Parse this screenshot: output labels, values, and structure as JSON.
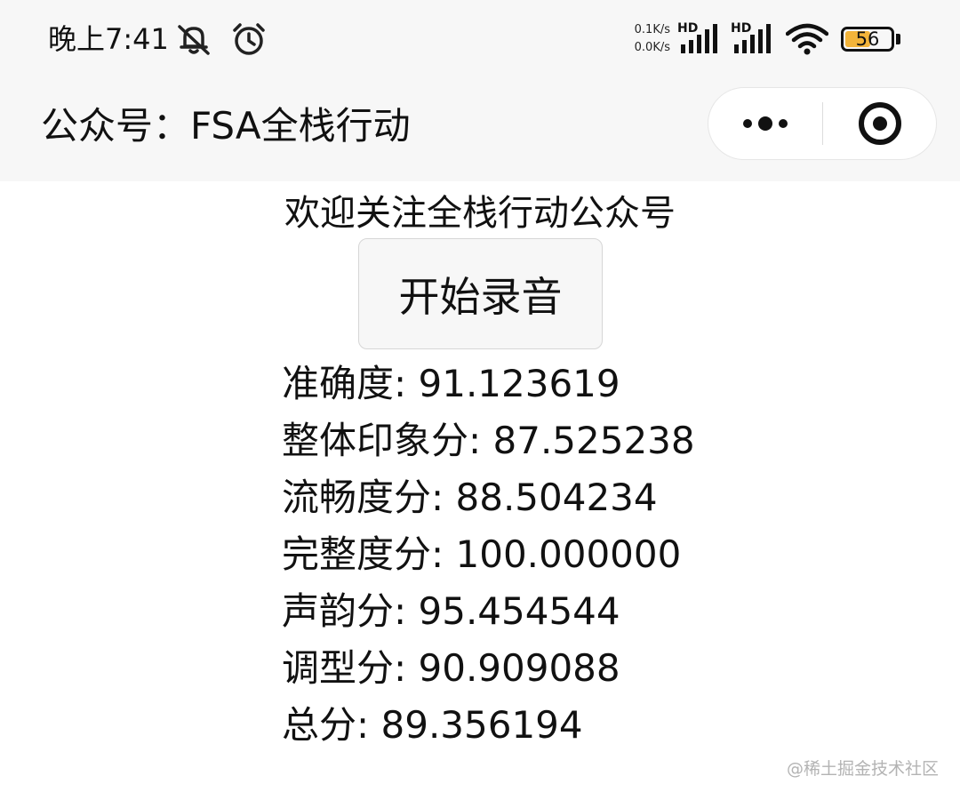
{
  "status_bar": {
    "time": "晚上7:41",
    "icons": [
      "mute-icon",
      "alarm-icon"
    ],
    "net_speed_up": "0.1K/s",
    "net_speed_down": "0.0K/s",
    "signal_1_label": "HD",
    "signal_2_label": "HD",
    "wifi_icon": "wifi-icon",
    "battery_level": "56",
    "battery_fraction": 0.56,
    "battery_color": "#f3b43a"
  },
  "nav_bar": {
    "title": "公众号：FSA全栈行动",
    "more_icon": "more-dots-icon",
    "close_icon": "miniprogram-close-icon"
  },
  "main": {
    "welcome_text": "欢迎关注全栈行动公众号",
    "record_button_label": "开始录音",
    "results": [
      "准确度: 91.123619",
      "整体印象分: 87.525238",
      "流畅度分: 88.504234",
      "完整度分: 100.000000",
      "声韵分: 95.454544",
      "调型分: 90.909088",
      "总分: 89.356194"
    ]
  },
  "watermark": "@稀土掘金技术社区"
}
